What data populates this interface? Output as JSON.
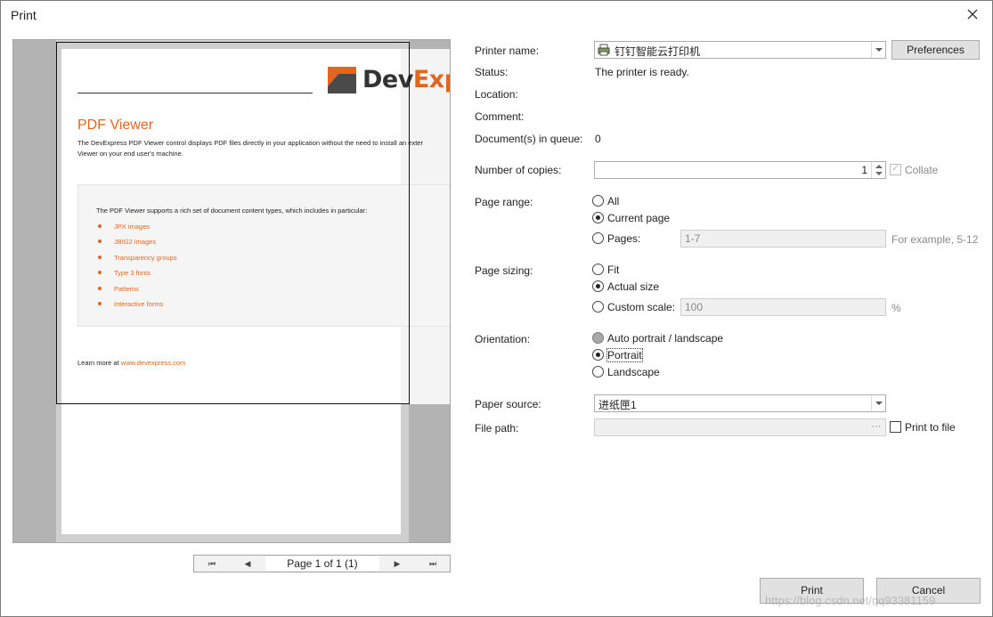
{
  "window": {
    "title": "Print",
    "close_icon": "close-icon"
  },
  "preview": {
    "doc_title": "PDF Viewer",
    "logo_prefix": "Dev",
    "logo_suffix": "Exp",
    "intro_line1": "The DevExpress PDF Viewer control displays PDF files directly in your application without the need to install an exter",
    "intro_line2": "Viewer on your end user's machine.",
    "box_heading": "The PDF Viewer supports a rich set of document content types, which includes in particular:",
    "list": [
      "JPX images",
      "JBIG2 images",
      "Transparency groups",
      "Type 3 fonts",
      "Patterns",
      "Interactive forms"
    ],
    "footer_prefix": "Learn more at ",
    "footer_link": "www.devexpress.com",
    "brand_color": "#e2661d"
  },
  "pager": {
    "first_icon": "first-page-icon",
    "prev_icon": "prev-page-icon",
    "label": "Page 1 of 1 (1)",
    "next_icon": "next-page-icon",
    "last_icon": "last-page-icon"
  },
  "settings": {
    "printer_name_label": "Printer name:",
    "printer_name_value": "钉钉智能云打印机",
    "preferences_label": "Preferences",
    "status_label": "Status:",
    "status_value": "The printer is ready.",
    "location_label": "Location:",
    "comment_label": "Comment:",
    "queue_label": "Document(s) in queue:",
    "queue_value": "0",
    "copies_label": "Number of copies:",
    "copies_value": "1",
    "collate_label": "Collate",
    "page_range_label": "Page range:",
    "range_all": "All",
    "range_current": "Current page",
    "range_pages": "Pages:",
    "pages_value": "1-7",
    "pages_hint": "For example, 5-12",
    "page_sizing_label": "Page sizing:",
    "sizing_fit": "Fit",
    "sizing_actual": "Actual size",
    "sizing_custom": "Custom scale:",
    "custom_value": "100",
    "percent": "%",
    "orientation_label": "Orientation:",
    "orient_auto": "Auto portrait / landscape",
    "orient_portrait": "Portrait",
    "orient_landscape": "Landscape",
    "paper_source_label": "Paper source:",
    "paper_source_value": "进纸匣1",
    "file_path_label": "File path:",
    "browse_label": "···",
    "print_to_file_label": "Print to file"
  },
  "footer": {
    "print_label": "Print",
    "cancel_label": "Cancel",
    "watermark": "https://blog.csdn.net/qq93381159"
  }
}
